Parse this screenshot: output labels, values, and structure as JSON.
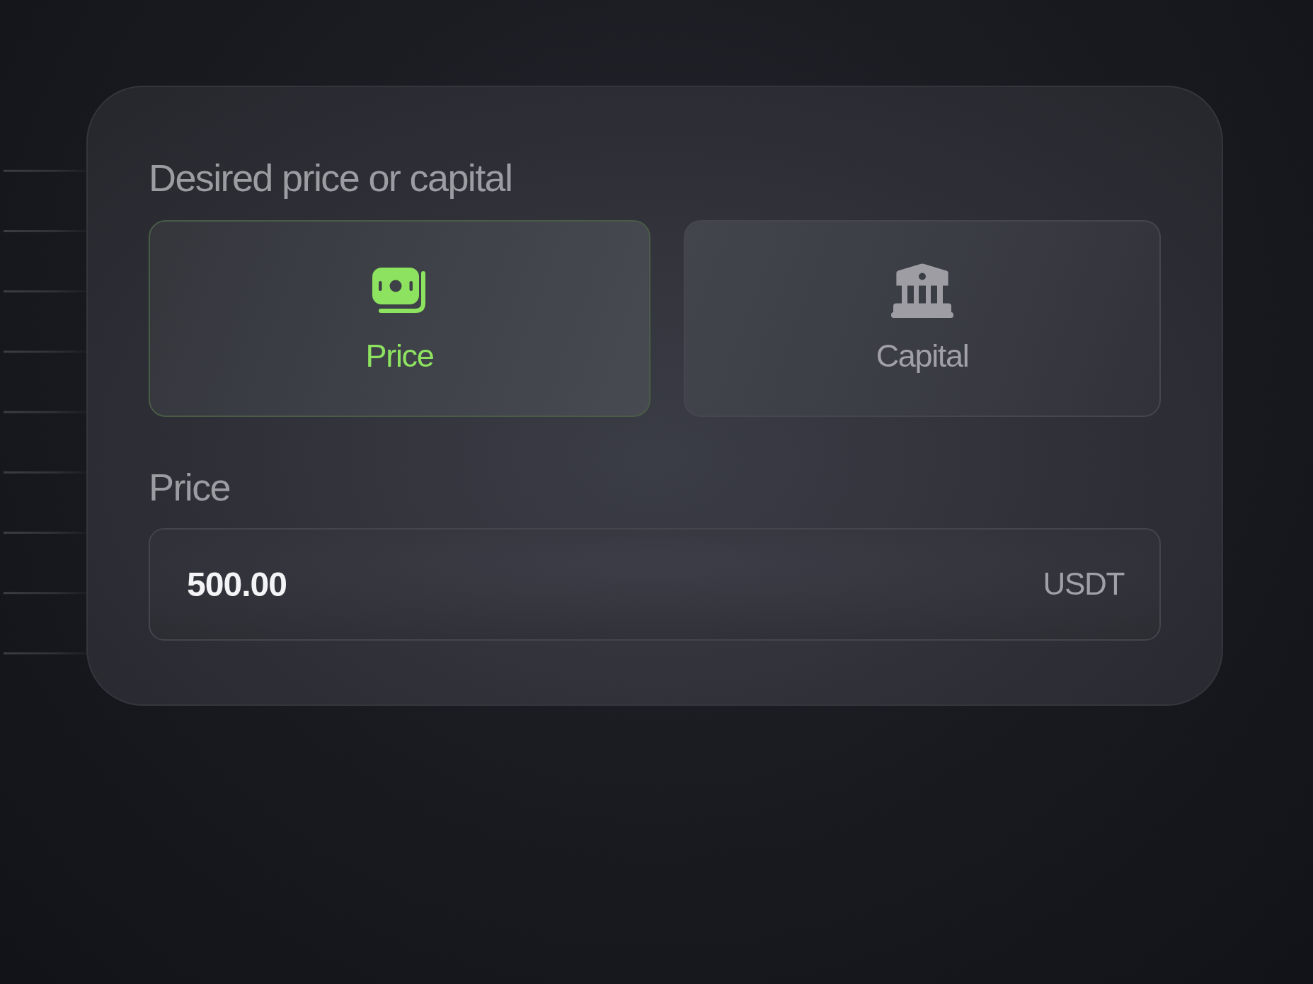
{
  "form": {
    "title": "Desired price or capital",
    "options": [
      {
        "kind": "price",
        "label": "Price",
        "selected": true
      },
      {
        "kind": "capital",
        "label": "Capital",
        "selected": false
      }
    ],
    "field": {
      "label": "Price",
      "value": "500.00",
      "unit": "USDT"
    }
  }
}
